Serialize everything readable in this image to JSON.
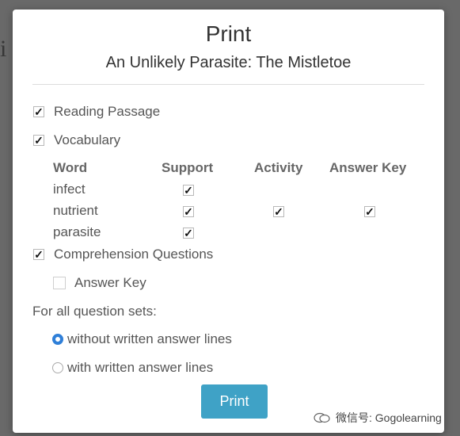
{
  "dialog": {
    "title": "Print",
    "subtitle": "An Unlikely Parasite: The Mistletoe"
  },
  "options": {
    "reading_passage": {
      "label": "Reading Passage",
      "checked": true
    },
    "vocabulary": {
      "label": "Vocabulary",
      "checked": true
    },
    "comprehension": {
      "label": "Comprehension Questions",
      "checked": true
    },
    "answer_key": {
      "label": "Answer Key",
      "checked": false
    }
  },
  "vocab_table": {
    "headers": [
      "Word",
      "Support",
      "Activity",
      "Answer Key"
    ],
    "rows": [
      {
        "word": "infect",
        "support": true,
        "activity": false,
        "answer_key": false
      },
      {
        "word": "nutrient",
        "support": true,
        "activity": true,
        "answer_key": true
      },
      {
        "word": "parasite",
        "support": true,
        "activity": false,
        "answer_key": false
      }
    ]
  },
  "question_sets": {
    "label": "For all question sets:",
    "options": [
      {
        "label": "without written answer lines",
        "selected": true
      },
      {
        "label": "with written answer lines",
        "selected": false
      }
    ]
  },
  "print_button": "Print",
  "watermark": "微信号: Gogolearning",
  "colors": {
    "accent": "#3fa2c6",
    "radio": "#2f7fd8"
  },
  "check_mark": "✓"
}
